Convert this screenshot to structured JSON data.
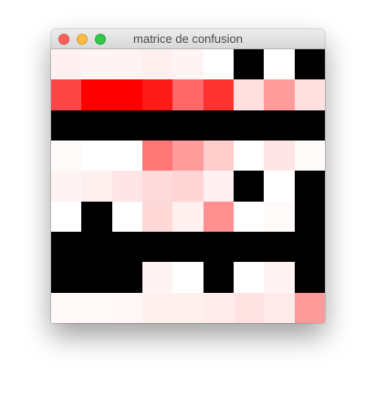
{
  "window": {
    "title": "matrice de confusion"
  },
  "chart_data": {
    "type": "heatmap",
    "title": "",
    "rows": 9,
    "cols": 9,
    "colors": [
      [
        "#fff1f1",
        "#fff4f4",
        "#fff3f3",
        "#ffefef",
        "#fff4f4",
        "#ffffff",
        "#000000",
        "#ffffff",
        "#000000"
      ],
      [
        "#ff4646",
        "#ff0000",
        "#ff0000",
        "#ff1a1a",
        "#ff6868",
        "#ff3232",
        "#ffe0e0",
        "#ff9c9c",
        "#ffe0e0"
      ],
      [
        "#000000",
        "#000000",
        "#000000",
        "#000000",
        "#000000",
        "#000000",
        "#000000",
        "#000000",
        "#000000"
      ],
      [
        "#fffafa",
        "#ffffff",
        "#ffffff",
        "#ff7676",
        "#ff9c9c",
        "#ffcbcb",
        "#ffffff",
        "#ffe5e5",
        "#fffafa"
      ],
      [
        "#fff3f3",
        "#fff0f0",
        "#ffe5e5",
        "#ffdada",
        "#ffd4d4",
        "#fff1f1",
        "#000000",
        "#ffffff",
        "#000000"
      ],
      [
        "#ffffff",
        "#000000",
        "#ffffff",
        "#ffd8d8",
        "#fff0f0",
        "#ff8e8e",
        "#ffffff",
        "#fffafa",
        "#000000"
      ],
      [
        "#000000",
        "#000000",
        "#000000",
        "#000000",
        "#000000",
        "#000000",
        "#000000",
        "#000000",
        "#000000"
      ],
      [
        "#000000",
        "#000000",
        "#000000",
        "#fff4f4",
        "#ffffff",
        "#000000",
        "#ffffff",
        "#fff3f3",
        "#000000"
      ],
      [
        "#fff9f9",
        "#fff9f9",
        "#fff7f7",
        "#fff0f0",
        "#fff0f0",
        "#ffeded",
        "#ffe3e3",
        "#ffeaea",
        "#ff9a9a"
      ]
    ]
  }
}
